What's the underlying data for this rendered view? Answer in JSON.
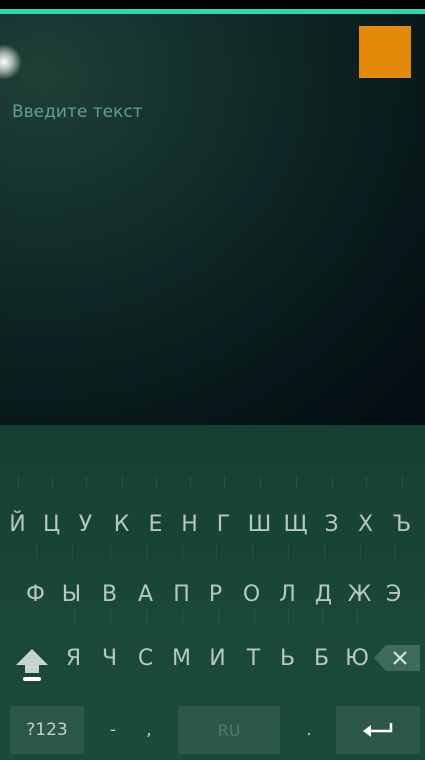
{
  "editor": {
    "placeholder": "Введите текст"
  },
  "colors": {
    "accent_line": "#2fd6b0",
    "action_button": "#e38a0a",
    "placeholder_text": "#5ba295",
    "key_text": "#b9c6c2",
    "keyboard_bg": "#1a4839"
  },
  "keyboard": {
    "row1": [
      "Й",
      "Ц",
      "У",
      "К",
      "Е",
      "Н",
      "Г",
      "Ш",
      "Щ",
      "З",
      "Х",
      "Ъ"
    ],
    "row2": [
      "Ф",
      "Ы",
      "В",
      "А",
      "П",
      "Р",
      "О",
      "Л",
      "Д",
      "Ж",
      "Э"
    ],
    "row3": [
      "Я",
      "Ч",
      "С",
      "М",
      "И",
      "Т",
      "Ь",
      "Б",
      "Ю"
    ],
    "bottom": {
      "symbols_label": "?123",
      "dash": "-",
      "comma": ",",
      "space_label": "RU",
      "period": "."
    },
    "icons": {
      "shift": "shift-arrow-icon",
      "backspace": "backspace-icon",
      "enter": "enter-return-icon"
    }
  }
}
